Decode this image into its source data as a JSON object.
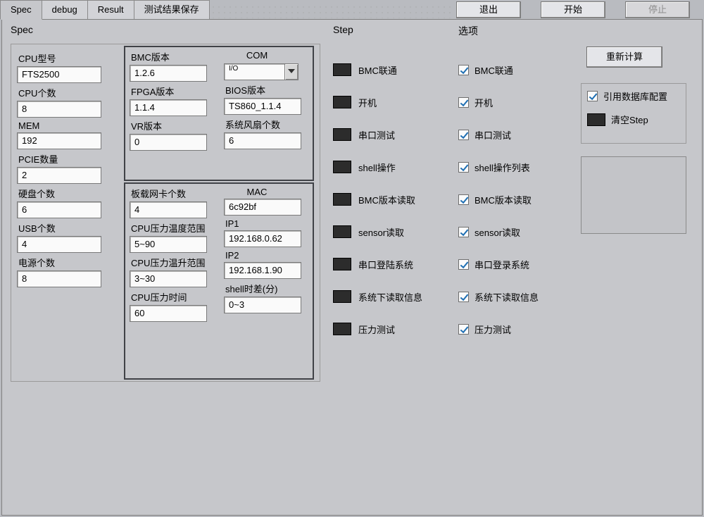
{
  "tabs": [
    "Spec",
    "debug",
    "Result",
    "测试结果保存"
  ],
  "active_tab": 0,
  "top_buttons": {
    "exit": "退出",
    "start": "开始",
    "stop": "停止"
  },
  "spec": {
    "title": "Spec",
    "left": {
      "cpu_model_lbl": "CPU型号",
      "cpu_model": "FTS2500",
      "cpu_cnt_lbl": "CPU个数",
      "cpu_cnt": "8",
      "mem_lbl": "MEM",
      "mem": "192",
      "pcie_lbl": "PCIE数量",
      "pcie": "2",
      "hdd_lbl": "硬盘个数",
      "hdd": "6",
      "usb_lbl": "USB个数",
      "usb": "4",
      "pwr_lbl": "电源个数",
      "pwr": "8"
    },
    "group_a": {
      "bmc_ver_lbl": "BMC版本",
      "bmc_ver": "1.2.6",
      "com_lbl": "COM",
      "com_prefix": "I/O",
      "fpga_lbl": "FPGA版本",
      "fpga": "1.1.4",
      "bios_lbl": "BIOS版本",
      "bios": "TS860_1.1.4",
      "vr_lbl": "VR版本",
      "vr": "0",
      "fan_lbl": "系统风扇个数",
      "fan": "6"
    },
    "group_b": {
      "nic_lbl": "板载网卡个数",
      "nic": "4",
      "mac_lbl": "MAC",
      "mac": "6c92bf",
      "temp_range_lbl": "CPU压力温度范围",
      "temp_range": "5~90",
      "ip1_lbl": "IP1",
      "ip1": "192.168.0.62",
      "temp_rise_lbl": "CPU压力温升范围",
      "temp_rise": "3~30",
      "ip2_lbl": "IP2",
      "ip2": "192.168.1.90",
      "cpu_time_lbl": "CPU压力时间",
      "cpu_time": "60",
      "shell_diff_lbl": "shell时差(分)",
      "shell_diff": "0~3"
    }
  },
  "step_title": "Step",
  "steps": [
    {
      "label": "BMC联通"
    },
    {
      "label": "开机"
    },
    {
      "label": "串口测试"
    },
    {
      "label": "shell操作"
    },
    {
      "label": "BMC版本读取"
    },
    {
      "label": "sensor读取"
    },
    {
      "label": "串口登陆系统"
    },
    {
      "label": "系统下读取信息"
    },
    {
      "label": "压力测试"
    }
  ],
  "options_title": "选项",
  "options": [
    {
      "label": "BMC联通"
    },
    {
      "label": "开机"
    },
    {
      "label": "串口测试"
    },
    {
      "label": "shell操作列表"
    },
    {
      "label": "BMC版本读取"
    },
    {
      "label": "sensor读取"
    },
    {
      "label": "串口登录系统"
    },
    {
      "label": "系统下读取信息"
    },
    {
      "label": "压力测试"
    }
  ],
  "right": {
    "recalc": "重新计算",
    "use_db": "引用数据库配置",
    "clear_step": "清空Step"
  }
}
